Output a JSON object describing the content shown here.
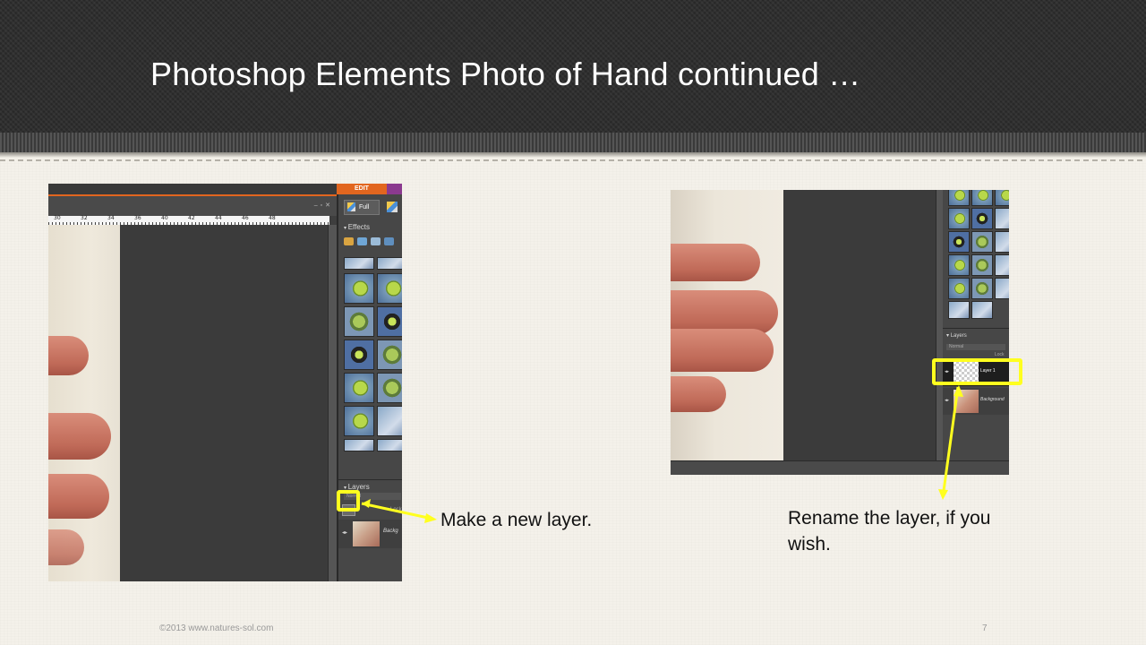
{
  "slide": {
    "title": "Photoshop Elements Photo of Hand continued …",
    "footer_left": "©2013 www.natures-sol.com",
    "page_number": "7"
  },
  "screenshot_left": {
    "edit_tab": "EDIT",
    "full_button": "Full",
    "ruler_marks": [
      "30",
      "32",
      "34",
      "36",
      "40",
      "42",
      "44",
      "46",
      "48"
    ],
    "effects_label": "Effects",
    "layers_label": "Layers",
    "blend_mode": "Normal",
    "lock_label": "Lock",
    "layer_name": "Backg"
  },
  "screenshot_right": {
    "layers_label": "Layers",
    "blend_mode": "Normal",
    "lock_label": "Lock",
    "layer1_name": "Layer 1",
    "background_name": "Background"
  },
  "captions": {
    "left": "Make a new layer.",
    "right": "Rename the layer, if you wish."
  },
  "colors": {
    "highlight": "#ffff1f",
    "edit_orange": "#e2661f",
    "title_text": "#ffffff"
  }
}
